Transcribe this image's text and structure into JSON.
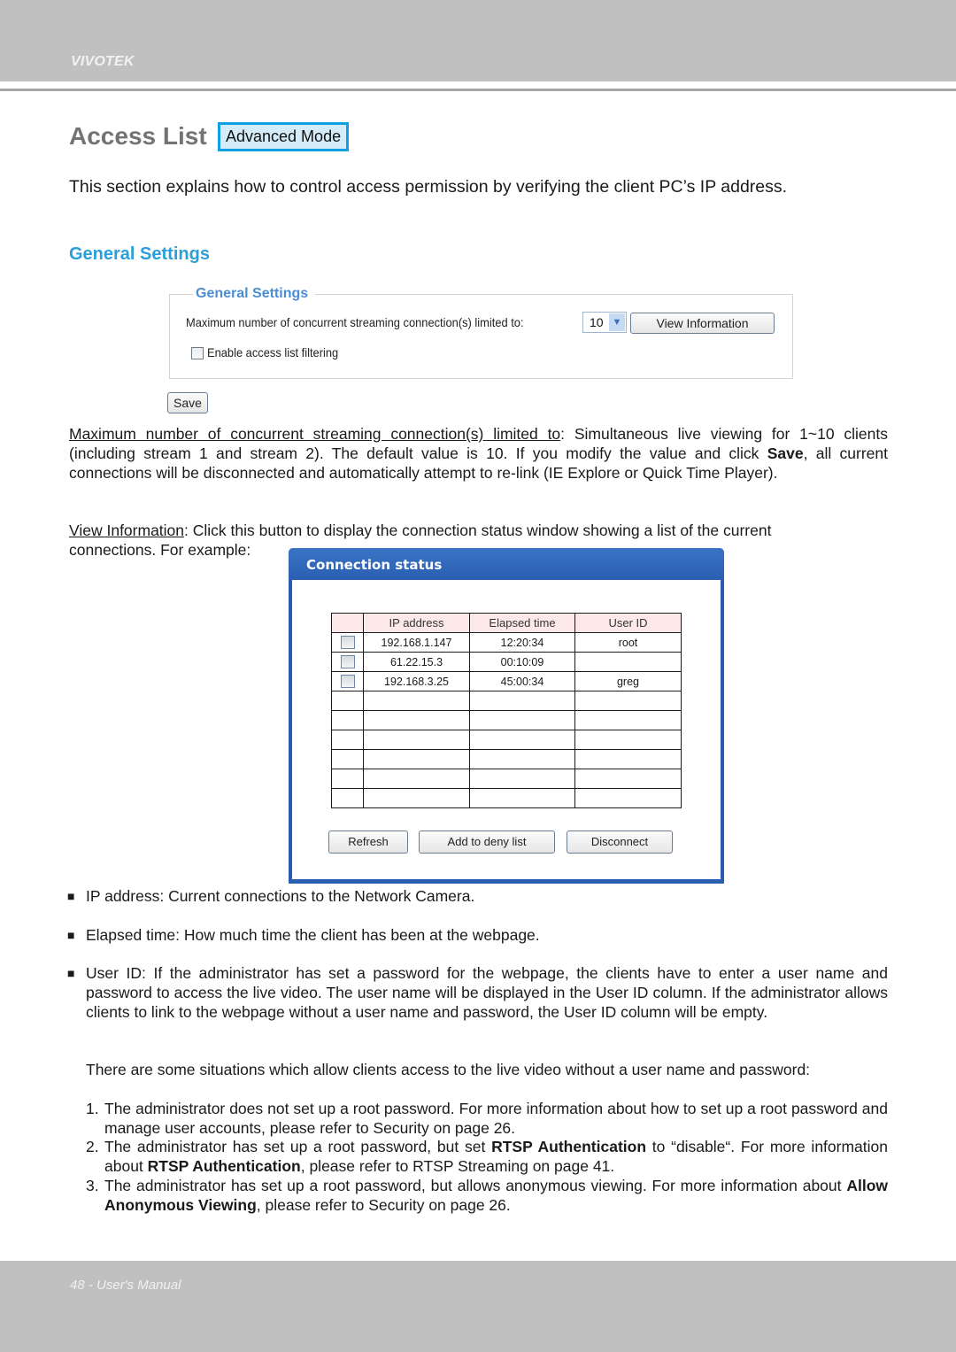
{
  "header": {
    "brand": "VIVOTEK"
  },
  "title": {
    "text": "Access List",
    "badge": "Advanced Mode"
  },
  "intro": "This section explains how to control access permission by verifying the client PC’s IP address.",
  "section_heading": "General Settings",
  "settings_panel": {
    "legend": "General Settings",
    "max_label": "Maximum number of concurrent streaming connection(s) limited to:",
    "max_value": "10",
    "view_button": "View Information",
    "enable_label": "Enable access list filtering",
    "enable_checked": false,
    "save_button": "Save"
  },
  "paragraph1": {
    "term": "Maximum number of concurrent streaming connection(s) limited to",
    "text_a": ": Simultaneous live viewing for 1~10 clients (including stream 1 and stream 2). The default value is 10. If you modify the value and click ",
    "bold": "Save",
    "text_b": ", all current connections will be disconnected and automatically attempt to re-link (IE Explore or Quick Time Player)."
  },
  "paragraph2": {
    "term": "View Information",
    "text": ": Click this button to display the connection status window showing a list of the current",
    "text2": "connections. For example:"
  },
  "dialog": {
    "title": "Connection status",
    "columns": [
      "IP address",
      "Elapsed time",
      "User ID"
    ],
    "rows": [
      {
        "ip": "192.168.1.147",
        "elapsed": "12:20:34",
        "user": "root"
      },
      {
        "ip": "61.22.15.3",
        "elapsed": "00:10:09",
        "user": ""
      },
      {
        "ip": "192.168.3.25",
        "elapsed": "45:00:34",
        "user": "greg"
      }
    ],
    "empty_rows": 6,
    "buttons": {
      "refresh": "Refresh",
      "deny": "Add to deny list",
      "disconnect": "Disconnect"
    }
  },
  "bullets": [
    "IP address: Current connections to the Network Camera.",
    "Elapsed time: How much time the client has been at the webpage.",
    "User ID: If the administrator has set a password for the webpage, the clients have to enter a user name and password to access the live video. The user name will be displayed in the User ID column. If the administrator allows clients to link to the webpage without a user name and password, the User ID column will be empty."
  ],
  "bullet_symbol": "■",
  "situations_intro": "There are some situations which allow clients access to the live video without a user name and password:",
  "situations": [
    {
      "num": "1.",
      "a": "The administrator does not set up a root password. For more information about how to set up a root password and manage user accounts, please refer to Security on page 26.",
      "b1": "",
      "m": "",
      "b2": "",
      "c": ""
    },
    {
      "num": "2.",
      "a": "The administrator has set up a root password, but set ",
      "b1": "RTSP Authentication",
      "m": " to “disable“. For more information about ",
      "b2": "RTSP Authentication",
      "c": ", please refer to RTSP Streaming on page 41."
    },
    {
      "num": "3.",
      "a": "The administrator has set up a root password, but allows anonymous viewing. For more information about ",
      "b1": "Allow Anonymous Viewing",
      "m": ", please refer to Security on page 26.",
      "b2": "",
      "c": ""
    }
  ],
  "footer": {
    "text": "48 - User's Manual"
  }
}
